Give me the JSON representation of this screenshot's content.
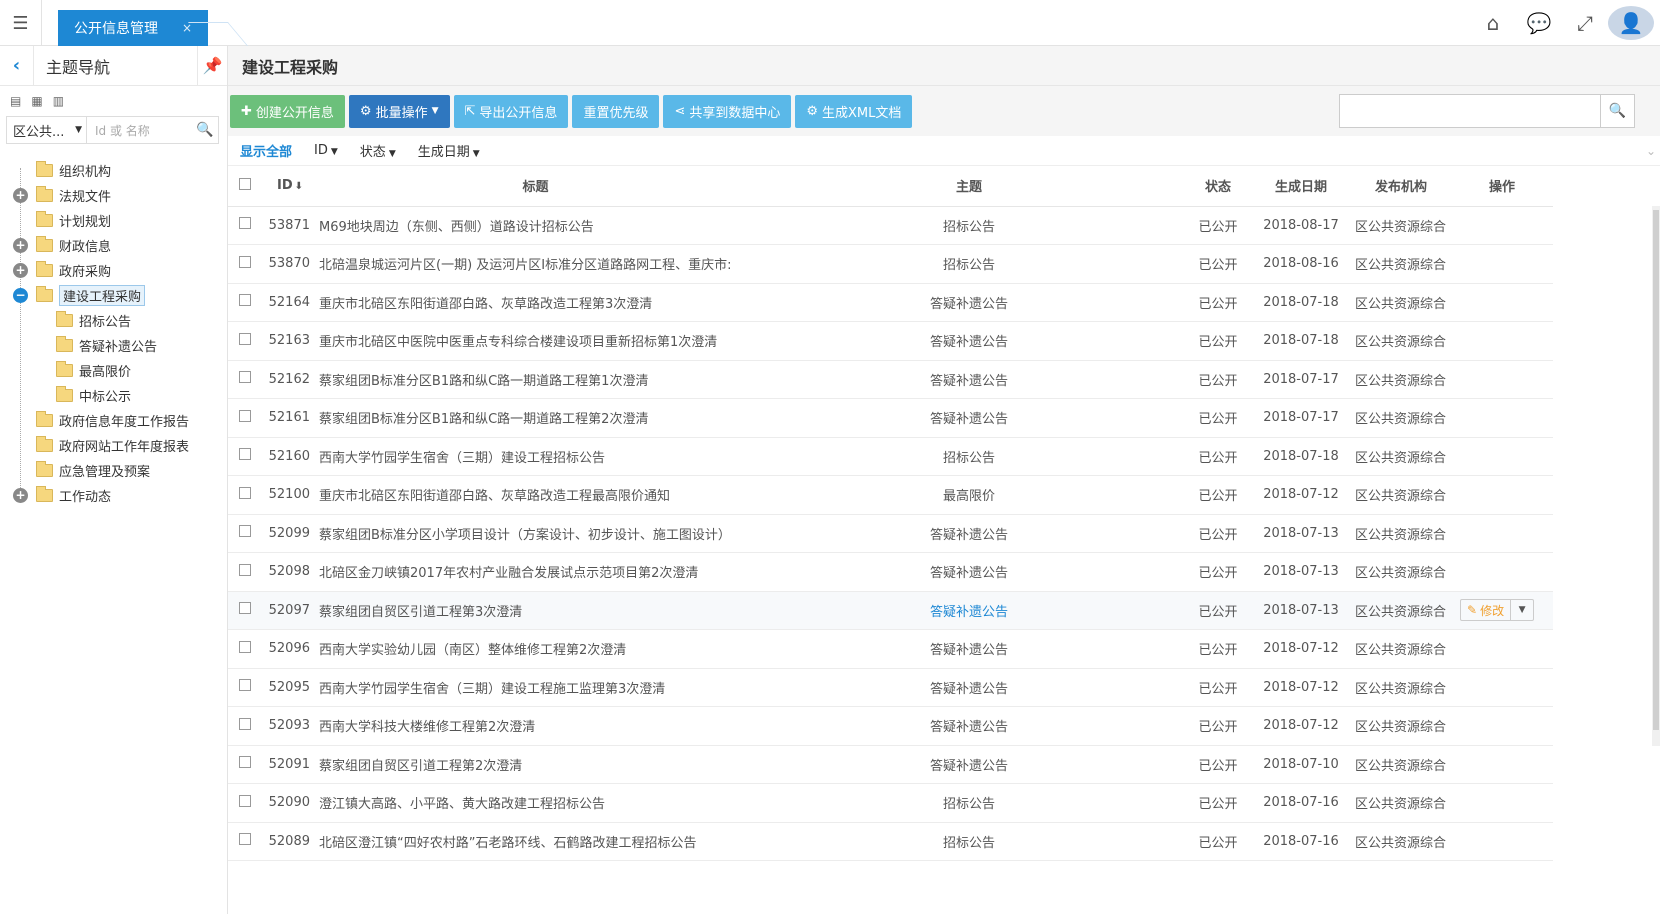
{
  "topbar": {
    "menu_icon": "hamburger-menu-icon",
    "active_tab": "公开信息管理",
    "tab_close": "×",
    "icons": [
      "home-icon",
      "chat-icon",
      "fullscreen-icon",
      "avatar"
    ]
  },
  "sidebar": {
    "title": "主题导航",
    "select_value": "区公共...",
    "search_placeholder": "Id 或 名称",
    "tree": [
      {
        "label": "组织机构",
        "level": 1,
        "toggle": ""
      },
      {
        "label": "法规文件",
        "level": 1,
        "toggle": "+"
      },
      {
        "label": "计划规划",
        "level": 1,
        "toggle": ""
      },
      {
        "label": "财政信息",
        "level": 1,
        "toggle": "+"
      },
      {
        "label": "政府采购",
        "level": 1,
        "toggle": "+"
      },
      {
        "label": "建设工程采购",
        "level": 1,
        "toggle": "−",
        "selected": true
      },
      {
        "label": "招标公告",
        "level": 2,
        "toggle": ""
      },
      {
        "label": "答疑补遗公告",
        "level": 2,
        "toggle": ""
      },
      {
        "label": "最高限价",
        "level": 2,
        "toggle": ""
      },
      {
        "label": "中标公示",
        "level": 2,
        "toggle": ""
      },
      {
        "label": "政府信息年度工作报告",
        "level": 1,
        "toggle": ""
      },
      {
        "label": "政府网站工作年度报表",
        "level": 1,
        "toggle": ""
      },
      {
        "label": "应急管理及预案",
        "level": 1,
        "toggle": ""
      },
      {
        "label": "工作动态",
        "level": 1,
        "toggle": "+"
      }
    ]
  },
  "main": {
    "title": "建设工程采购",
    "buttons": {
      "create": "创建公开信息",
      "batch": "批量操作",
      "export": "导出公开信息",
      "reset": "重置优先级",
      "share": "共享到数据中心",
      "xml": "生成XML文档"
    },
    "filters": {
      "all": "显示全部",
      "id": "ID",
      "status": "状态",
      "date": "生成日期"
    },
    "columns": {
      "id": "ID",
      "title": "标题",
      "topic": "主题",
      "status": "状态",
      "date": "生成日期",
      "org": "发布机构",
      "op": "操作"
    },
    "edit_label": "修改",
    "rows": [
      {
        "id": "53871",
        "title": "M69地块周边（东侧、西侧）道路设计招标公告",
        "topic": "招标公告",
        "status": "已公开",
        "date": "2018-08-17",
        "org": "区公共资源综合"
      },
      {
        "id": "53870",
        "title": "北碚温泉城运河片区(一期) 及运河片区I标准分区道路路网工程、重庆市:",
        "topic": "招标公告",
        "status": "已公开",
        "date": "2018-08-16",
        "org": "区公共资源综合"
      },
      {
        "id": "52164",
        "title": "重庆市北碚区东阳街道邵白路、灰草路改造工程第3次澄清",
        "topic": "答疑补遗公告",
        "status": "已公开",
        "date": "2018-07-18",
        "org": "区公共资源综合"
      },
      {
        "id": "52163",
        "title": "重庆市北碚区中医院中医重点专科综合楼建设项目重新招标第1次澄清",
        "topic": "答疑补遗公告",
        "status": "已公开",
        "date": "2018-07-18",
        "org": "区公共资源综合"
      },
      {
        "id": "52162",
        "title": "蔡家组团B标准分区B1路和纵C路一期道路工程第1次澄清",
        "topic": "答疑补遗公告",
        "status": "已公开",
        "date": "2018-07-17",
        "org": "区公共资源综合"
      },
      {
        "id": "52161",
        "title": "蔡家组团B标准分区B1路和纵C路一期道路工程第2次澄清",
        "topic": "答疑补遗公告",
        "status": "已公开",
        "date": "2018-07-17",
        "org": "区公共资源综合"
      },
      {
        "id": "52160",
        "title": "西南大学竹园学生宿舍（三期）建设工程招标公告",
        "topic": "招标公告",
        "status": "已公开",
        "date": "2018-07-18",
        "org": "区公共资源综合"
      },
      {
        "id": "52100",
        "title": "重庆市北碚区东阳街道邵白路、灰草路改造工程最高限价通知",
        "topic": "最高限价",
        "status": "已公开",
        "date": "2018-07-12",
        "org": "区公共资源综合"
      },
      {
        "id": "52099",
        "title": "蔡家组团B标准分区小学项目设计（方案设计、初步设计、施工图设计）",
        "topic": "答疑补遗公告",
        "status": "已公开",
        "date": "2018-07-13",
        "org": "区公共资源综合"
      },
      {
        "id": "52098",
        "title": "北碚区金刀峡镇2017年农村产业融合发展试点示范项目第2次澄清",
        "topic": "答疑补遗公告",
        "status": "已公开",
        "date": "2018-07-13",
        "org": "区公共资源综合"
      },
      {
        "id": "52097",
        "title": "蔡家组团自贸区引道工程第3次澄清",
        "topic": "答疑补遗公告",
        "status": "已公开",
        "date": "2018-07-13",
        "org": "区公共资源综合",
        "highlight": true
      },
      {
        "id": "52096",
        "title": "西南大学实验幼儿园（南区）整体维修工程第2次澄清",
        "topic": "答疑补遗公告",
        "status": "已公开",
        "date": "2018-07-12",
        "org": "区公共资源综合"
      },
      {
        "id": "52095",
        "title": "西南大学竹园学生宿舍（三期）建设工程施工监理第3次澄清",
        "topic": "答疑补遗公告",
        "status": "已公开",
        "date": "2018-07-12",
        "org": "区公共资源综合"
      },
      {
        "id": "52093",
        "title": "西南大学科技大楼维修工程第2次澄清",
        "topic": "答疑补遗公告",
        "status": "已公开",
        "date": "2018-07-12",
        "org": "区公共资源综合"
      },
      {
        "id": "52091",
        "title": "蔡家组团自贸区引道工程第2次澄清",
        "topic": "答疑补遗公告",
        "status": "已公开",
        "date": "2018-07-10",
        "org": "区公共资源综合"
      },
      {
        "id": "52090",
        "title": "澄江镇大高路、小平路、黄大路改建工程招标公告",
        "topic": "招标公告",
        "status": "已公开",
        "date": "2018-07-16",
        "org": "区公共资源综合"
      },
      {
        "id": "52089",
        "title": "北碚区澄江镇“四好农村路”石老路环线、石鹤路改建工程招标公告",
        "topic": "招标公告",
        "status": "已公开",
        "date": "2018-07-16",
        "org": "区公共资源综合"
      }
    ]
  }
}
